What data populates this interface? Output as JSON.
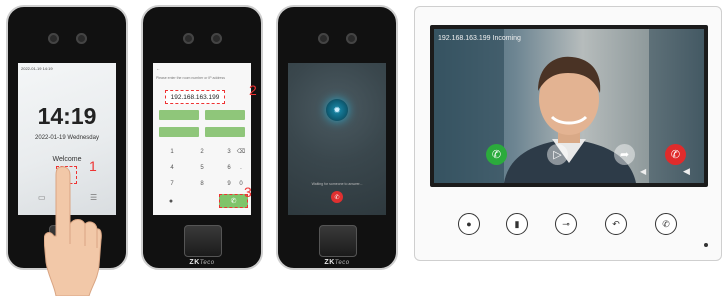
{
  "screen1": {
    "status": "2022-01-19 14:19",
    "time": "14:19",
    "date": "2022-01-19   Wednesday",
    "welcome": "Welcome",
    "step": "1"
  },
  "screen2": {
    "prompt": "Please enter the room number or IP address",
    "ip": "192.168.163.199",
    "step_ip": "2",
    "step_call": "3",
    "keys": [
      "1",
      "2",
      "3",
      "⌫",
      "4",
      "5",
      "6",
      ".",
      "7",
      "8",
      "9",
      "0"
    ]
  },
  "screen3": {
    "waiting": "Waiting for someone to answer..."
  },
  "brand": {
    "name": "ZK",
    "suffix": "Teco"
  },
  "monitor": {
    "caption": "192.168.163.199  Incoming"
  },
  "colors": {
    "annotation": "#e33333",
    "accept_call": "#2bab3c",
    "decline_call": "#e02b2b",
    "keypad_green": "#8fc67a"
  }
}
